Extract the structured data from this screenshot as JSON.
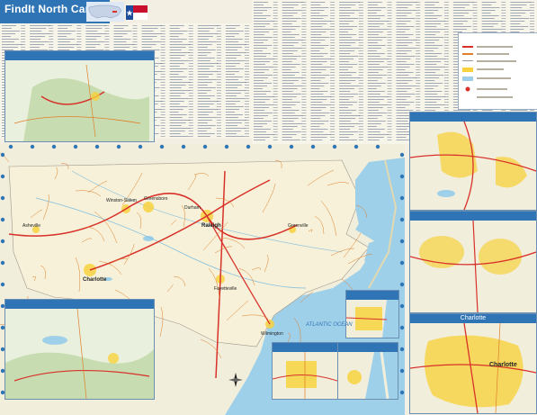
{
  "title": {
    "find": "FindIt",
    "state": "North Carolina"
  },
  "colors": {
    "title_bar": "#2f75b5",
    "water": "#9fd0ea",
    "land": "#f2eedc",
    "urban": "#f7d23e",
    "highway": "#d8312a",
    "road": "#e07f2b"
  },
  "insets": [
    {
      "id": "western",
      "label": ""
    },
    {
      "id": "northeast",
      "label": ""
    },
    {
      "id": "triad",
      "label": ""
    },
    {
      "id": "charlotte",
      "label": "Charlotte"
    },
    {
      "id": "eastern",
      "label": ""
    },
    {
      "id": "wilmington",
      "label": ""
    },
    {
      "id": "fayetteville",
      "label": ""
    }
  ],
  "legend": {
    "title": ""
  },
  "ocean_label": "ATLANTIC OCEAN",
  "cities": [
    "Charlotte",
    "Raleigh",
    "Durham",
    "Greensboro",
    "Winston-Salem",
    "Fayetteville",
    "Wilmington",
    "Asheville",
    "Greenville"
  ]
}
